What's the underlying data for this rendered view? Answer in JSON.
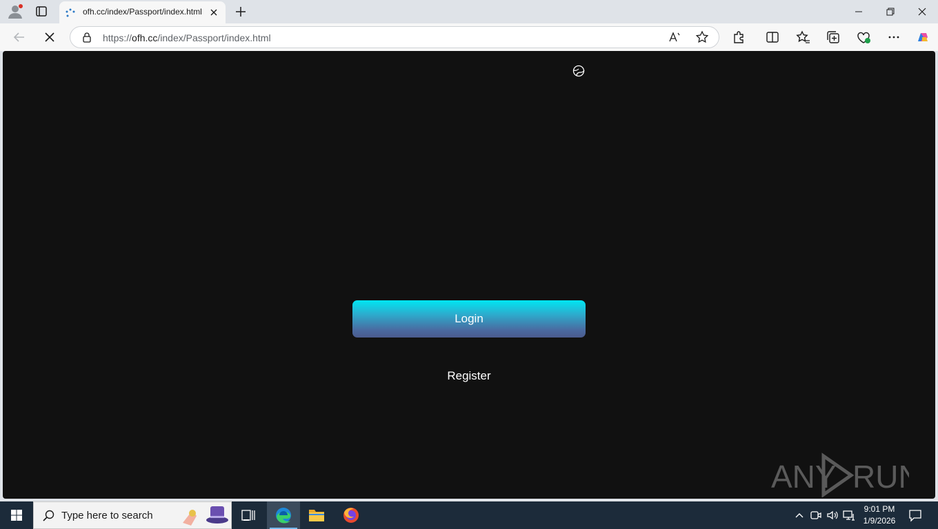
{
  "browser": {
    "tab": {
      "title": "ofh.cc/index/Passport/index.html"
    },
    "address_bar": {
      "url_prefix": "https://",
      "url_host": "ofh.cc",
      "url_path": "/index/Passport/index.html"
    }
  },
  "page": {
    "login_label": "Login",
    "register_label": "Register",
    "watermark": {
      "left": "ANY",
      "right": "RUN"
    }
  },
  "taskbar": {
    "search_placeholder": "Type here to search",
    "clock": {
      "time": "9:01 PM",
      "date": "1/9/2026"
    }
  },
  "colors": {
    "page_background": "#111111",
    "login_gradient_top": "#00e6f2",
    "login_gradient_bottom": "#4b5b8e",
    "taskbar": "#1c2b3a"
  },
  "icons": {
    "browser": [
      "profile-icon",
      "tab-actions-icon",
      "tab-favicon",
      "close-icon",
      "new-tab-icon",
      "minimize-icon",
      "restore-icon",
      "window-close-icon",
      "back-icon",
      "stop-loading-icon",
      "lock-icon",
      "read-aloud-icon",
      "favorite-star-icon",
      "extensions-icon",
      "split-screen-icon",
      "favorites-icon",
      "collections-icon",
      "browser-essentials-icon",
      "more-icon",
      "copilot-icon"
    ],
    "page": [
      "globe-icon"
    ],
    "taskbar": [
      "windows-start-icon",
      "search-icon",
      "task-view-icon",
      "edge-icon",
      "file-explorer-icon",
      "firefox-icon",
      "chevron-up-icon",
      "meet-now-icon",
      "volume-icon",
      "network-icon",
      "notification-icon"
    ]
  }
}
